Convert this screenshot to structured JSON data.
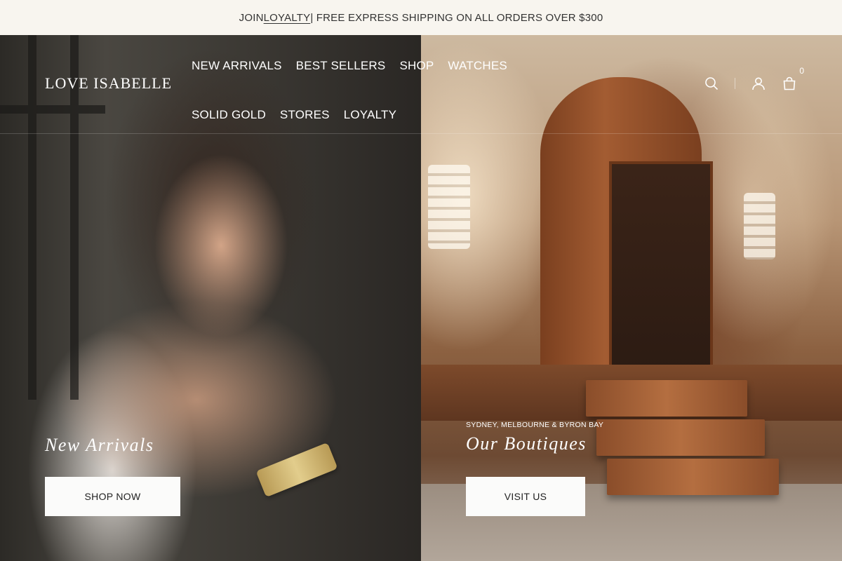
{
  "announcement": {
    "prefix": "JOIN ",
    "link": "LOYALTY",
    "suffix": " | FREE EXPRESS SHIPPING ON ALL ORDERS OVER $300"
  },
  "header": {
    "logo": "LOVE ISABELLE",
    "nav": [
      "NEW ARRIVALS",
      "BEST SELLERS",
      "SHOP",
      "WATCHES",
      "SOLID GOLD",
      "STORES",
      "LOYALTY"
    ],
    "cart_count": "0",
    "icons": [
      "search-icon",
      "account-icon",
      "cart-icon"
    ]
  },
  "hero_left": {
    "title": "New Arrivals",
    "cta": "SHOP NOW"
  },
  "hero_right": {
    "eyebrow": "SYDNEY, MELBOURNE & BYRON BAY",
    "title": "Our Boutiques",
    "cta": "VISIT US"
  },
  "colors": {
    "announcement_bg": "#f8f5ef",
    "button_bg": "#fbfbfa",
    "header_text": "#ffffff"
  }
}
